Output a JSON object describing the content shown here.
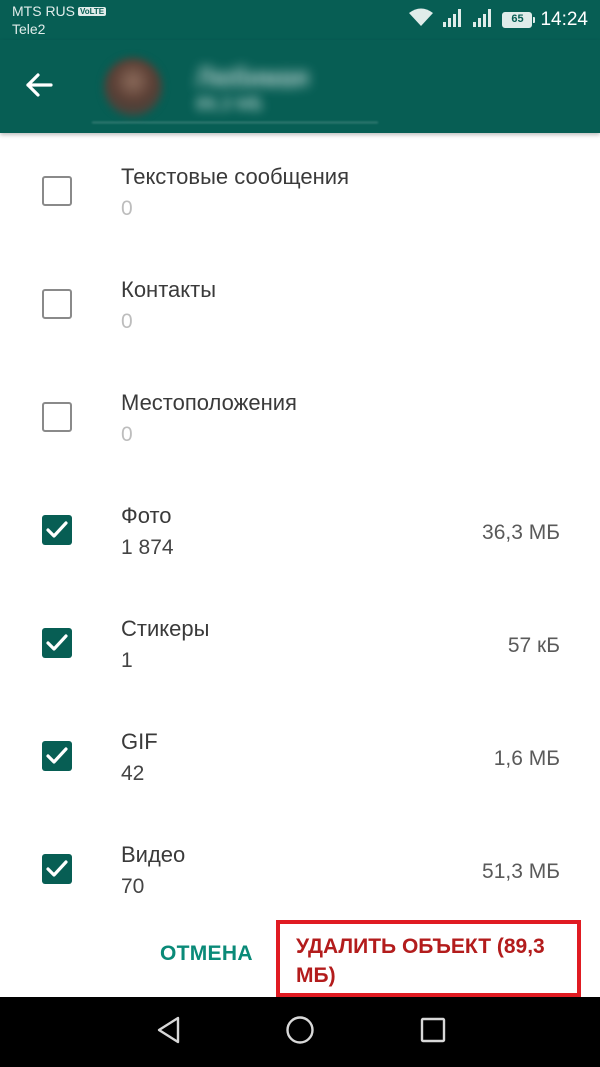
{
  "status_bar": {
    "carrier_primary": "MTS RUS",
    "volte_badge": "VoLTE",
    "carrier_secondary": "Tele2",
    "battery_level": "65",
    "time": "14:24",
    "icons": [
      "wifi-icon",
      "signal-icon",
      "signal-icon",
      "battery-icon"
    ]
  },
  "header": {
    "contact_name": "Любимая",
    "contact_subtitle": "89,3 МБ",
    "icons": [
      "back-arrow-icon",
      "avatar"
    ]
  },
  "items": [
    {
      "label": "Текстовые сообщения",
      "count": "0",
      "size": "",
      "checked": false
    },
    {
      "label": "Контакты",
      "count": "0",
      "size": "",
      "checked": false
    },
    {
      "label": "Местоположения",
      "count": "0",
      "size": "",
      "checked": false
    },
    {
      "label": "Фото",
      "count": "1 874",
      "size": "36,3 МБ",
      "checked": true
    },
    {
      "label": "Стикеры",
      "count": "1",
      "size": "57 кБ",
      "checked": true
    },
    {
      "label": "GIF",
      "count": "42",
      "size": "1,6 МБ",
      "checked": true
    },
    {
      "label": "Видео",
      "count": "70",
      "size": "51,3 МБ",
      "checked": true
    }
  ],
  "actions": {
    "cancel_label": "ОТМЕНА",
    "delete_label": "УДАЛИТЬ ОБЪЕКТ (89,3 МБ)"
  },
  "nav_bar": {
    "icons": [
      "back-triangle-icon",
      "home-circle-icon",
      "recents-square-icon"
    ]
  },
  "colors": {
    "primary": "#075e54",
    "accent": "#0a8a78",
    "highlight_frame": "#e01b22",
    "delete_text": "#b31c1c"
  }
}
